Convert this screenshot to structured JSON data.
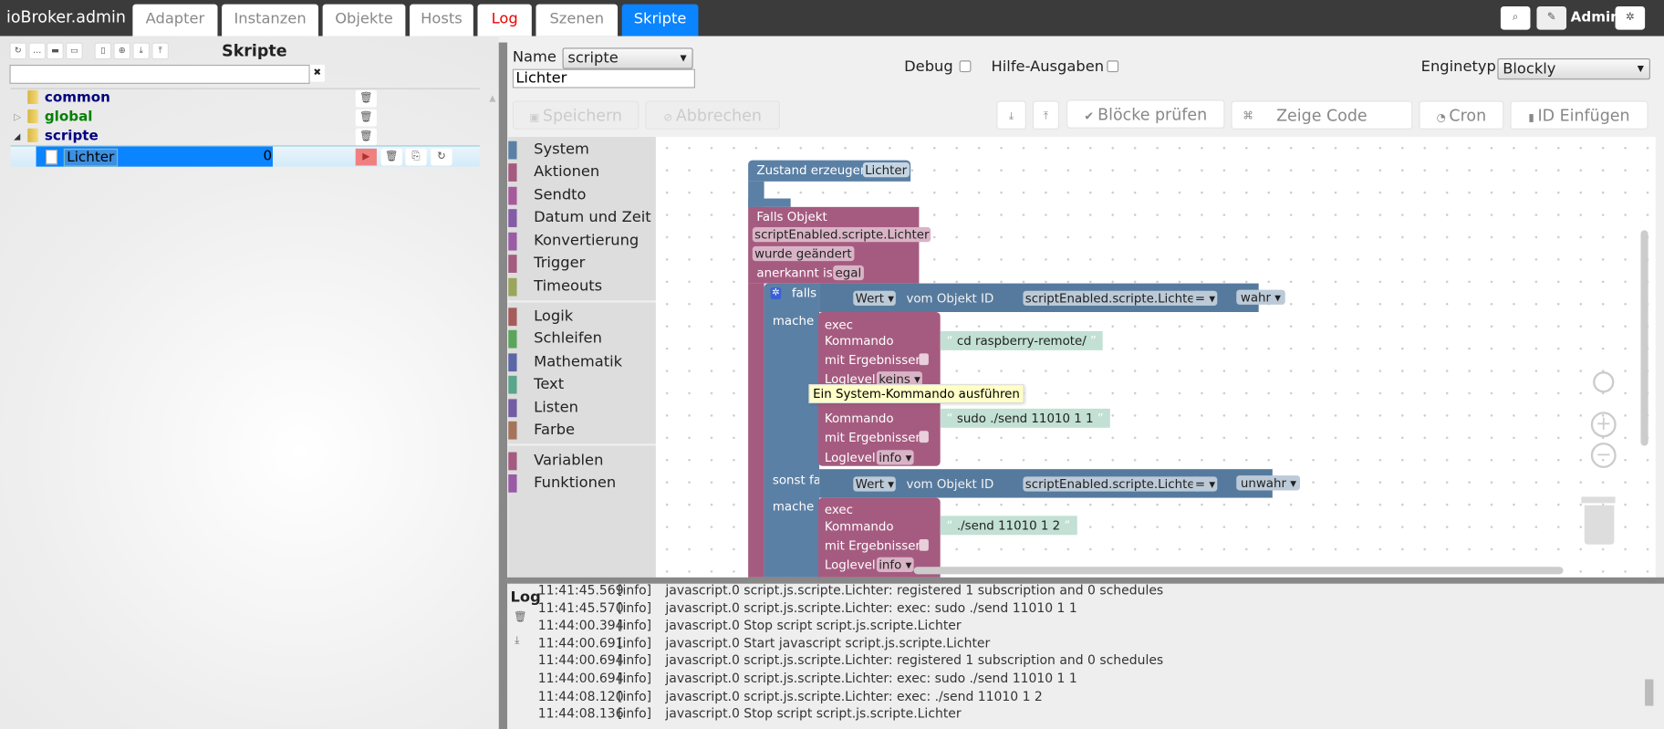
{
  "app": {
    "title": "ioBroker.admin",
    "user": "Admin"
  },
  "tabs": [
    {
      "label": "Adapter"
    },
    {
      "label": "Instanzen"
    },
    {
      "label": "Objekte"
    },
    {
      "label": "Hosts"
    },
    {
      "label": "Log"
    },
    {
      "label": "Szenen"
    },
    {
      "label": "Skripte"
    }
  ],
  "colors": {
    "accent": "#0a84ff",
    "log_tab": "#ee0000",
    "topbar": "#3b3b3b",
    "block_blue": "#5b80a5",
    "block_magenta": "#a55b80"
  },
  "left": {
    "title": "Skripte",
    "search_placeholder": "",
    "clear": "✖",
    "tree": [
      {
        "name": "common",
        "color": "#000080"
      },
      {
        "name": "global",
        "color": "#008000"
      },
      {
        "name": "scripte",
        "color": "#000080"
      }
    ],
    "selected": {
      "name": "Lichter",
      "value": "0"
    }
  },
  "editor": {
    "name_label": "Name",
    "folder": "scripte",
    "script_name": "Lichter",
    "debug_label": "Debug",
    "help_label": "Hilfe-Ausgaben",
    "engine_label": "Enginetyp",
    "engine": "Blockly",
    "buttons": {
      "save": "Speichern",
      "cancel": "Abbrechen",
      "check": "Blöcke prüfen",
      "code": "Zeige Code",
      "cron": "Cron",
      "id": "ID Einfügen"
    }
  },
  "toolbox": [
    [
      "System",
      "#5b80a5"
    ],
    [
      "Aktionen",
      "#a55b80"
    ],
    [
      "Sendto",
      "#a55b9b"
    ],
    [
      "Datum und Zeit",
      "#845ba5"
    ],
    [
      "Konvertierung",
      "#9b5ba5"
    ],
    [
      "Trigger",
      "#a55b80"
    ],
    [
      "Timeouts",
      "#9ba55b"
    ],
    [
      "Logik",
      "#a55b5b"
    ],
    [
      "Schleifen",
      "#5ba55b"
    ],
    [
      "Mathematik",
      "#5b67a5"
    ],
    [
      "Text",
      "#5ba58c"
    ],
    [
      "Listen",
      "#745ba5"
    ],
    [
      "Farbe",
      "#a5745b"
    ],
    [
      "Variablen",
      "#a55b80"
    ],
    [
      "Funktionen",
      "#995ba5"
    ]
  ],
  "blocks": {
    "create": {
      "label": "Zustand erzeugen",
      "value": "Lichter"
    },
    "trigger": {
      "label": "Falls Objekt",
      "oid": "scriptEnabled.scripte.Lichter",
      "event": "wurde geändert",
      "ack_label": "anerkannt ist",
      "ack": "egal"
    },
    "if": {
      "falls": "falls",
      "mache": "mache",
      "sonst": "sonst falls",
      "wert": "Wert",
      "vom": "vom Objekt ID",
      "oid": "scriptEnabled.scripte.Lichter",
      "op": "=",
      "val1": "wahr",
      "val2": "unwahr"
    },
    "exec": {
      "title": "exec",
      "cmd_label": "Kommando",
      "res_label": "mit Ergebnissen",
      "log_label": "Loglevel",
      "cmd1": "cd raspberry-remote/",
      "log1": "keins",
      "cmd2": "sudo ./send 11010 1 1",
      "log2": "info",
      "cmd3": "./send 11010 1 2",
      "log3": "info"
    },
    "tooltip": "Ein System-Kommando ausführen"
  },
  "log": {
    "title": "Log",
    "lines": [
      [
        "11:41:45.569",
        "[info]",
        "javascript.0 script.js.scripte.Lichter: registered 1 subscription and 0 schedules"
      ],
      [
        "11:41:45.570",
        "[info]",
        "javascript.0 script.js.scripte.Lichter: exec: sudo ./send 11010 1 1"
      ],
      [
        "11:44:00.394",
        "[info]",
        "javascript.0 Stop script script.js.scripte.Lichter"
      ],
      [
        "11:44:00.691",
        "[info]",
        "javascript.0 Start javascript script.js.scripte.Lichter"
      ],
      [
        "11:44:00.694",
        "[info]",
        "javascript.0 script.js.scripte.Lichter: registered 1 subscription and 0 schedules"
      ],
      [
        "11:44:00.694",
        "[info]",
        "javascript.0 script.js.scripte.Lichter: exec: sudo ./send 11010 1 1"
      ],
      [
        "11:44:08.120",
        "[info]",
        "javascript.0 script.js.scripte.Lichter: exec: ./send 11010 1 2"
      ],
      [
        "11:44:08.136",
        "[info]",
        "javascript.0 Stop script script.js.scripte.Lichter"
      ]
    ]
  }
}
